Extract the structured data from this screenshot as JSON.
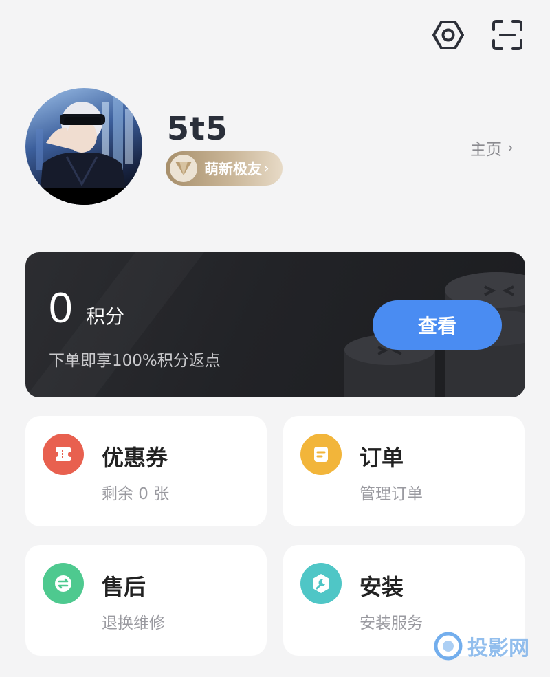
{
  "profile": {
    "username": "5t5",
    "badge_label": "萌新极友",
    "homepage_label": "主页"
  },
  "points": {
    "value": "0",
    "unit": "积分",
    "description": "下单即享100%积分返点",
    "view_label": "查看"
  },
  "tiles": [
    {
      "title": "优惠券",
      "subtitle": "剩余 0 张",
      "icon": "ticket-icon",
      "color": "#e8604f"
    },
    {
      "title": "订单",
      "subtitle": "管理订单",
      "icon": "order-icon",
      "color": "#f2b53a"
    },
    {
      "title": "售后",
      "subtitle": "退换维修",
      "icon": "exchange-icon",
      "color": "#4ec98f"
    },
    {
      "title": "安装",
      "subtitle": "安装服务",
      "icon": "wrench-icon",
      "color": "#4fc6c6"
    }
  ],
  "watermark": {
    "text": "投影网"
  },
  "icons": {
    "settings": "settings-icon",
    "scan": "scan-icon",
    "gem": "gem-icon",
    "avatar": "avatar"
  }
}
